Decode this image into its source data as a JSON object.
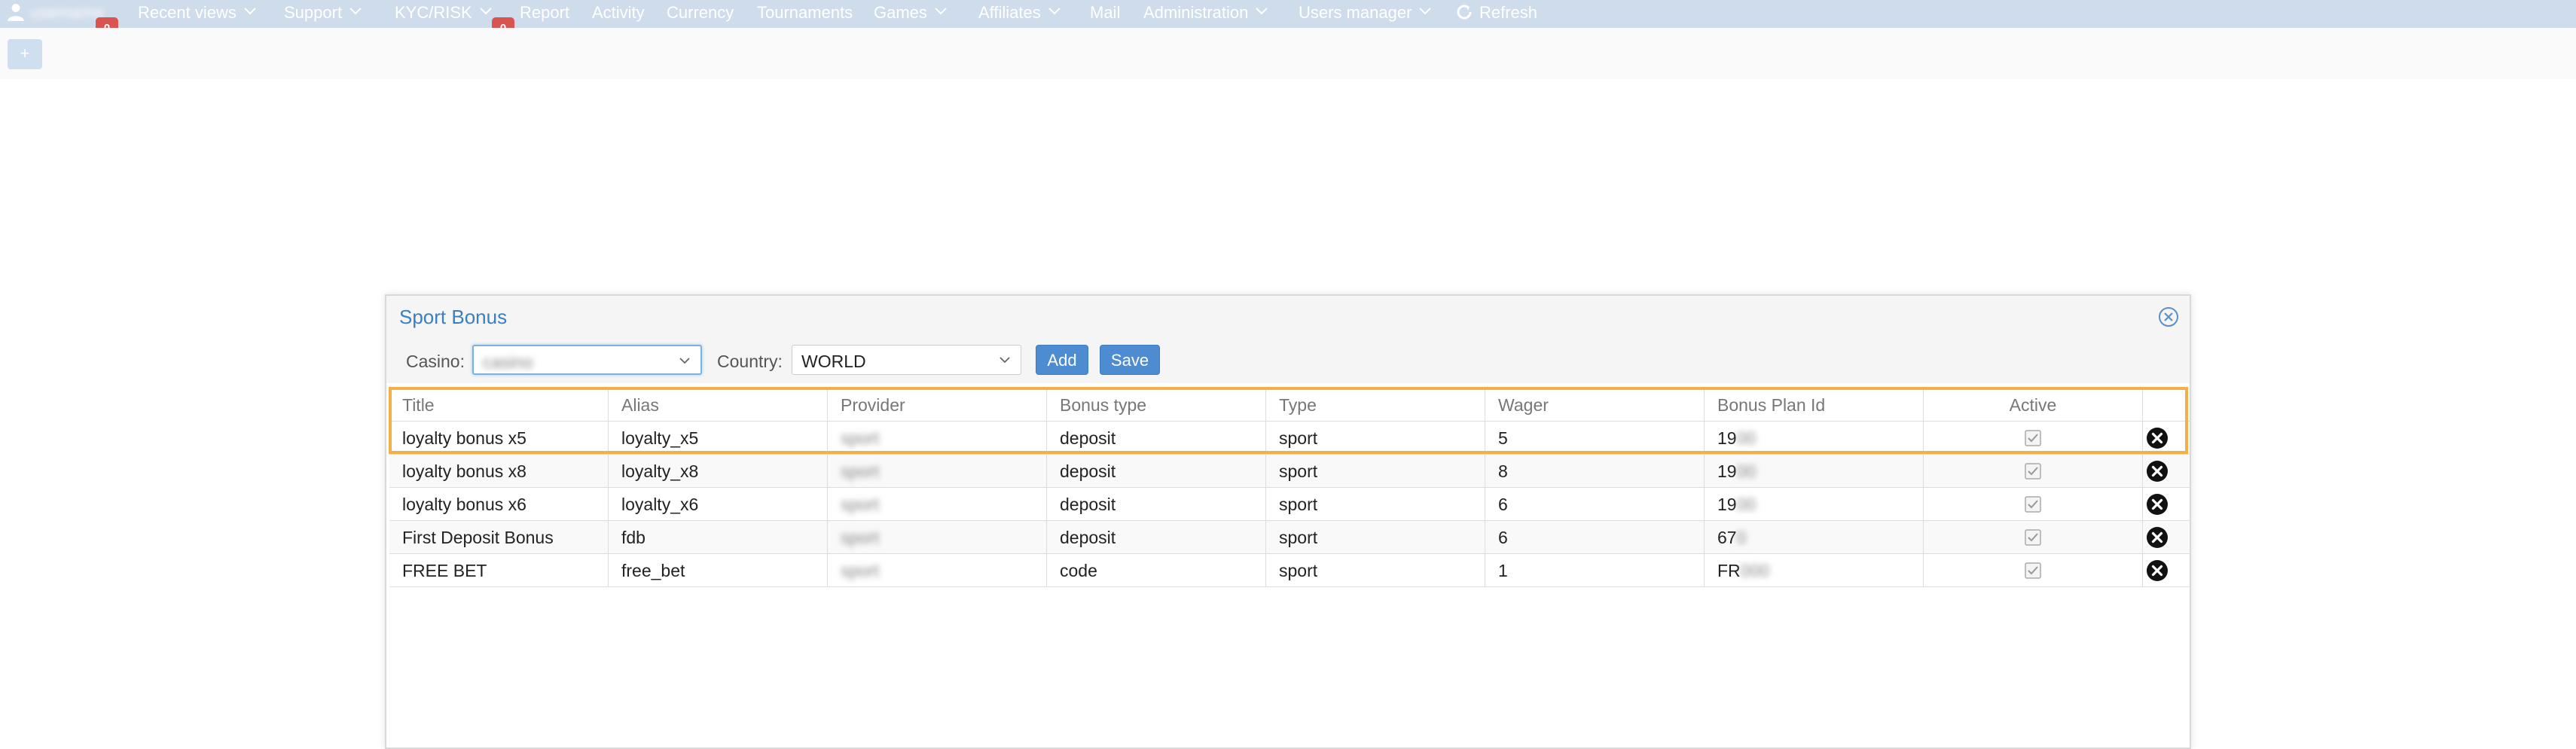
{
  "navbar": {
    "user_name": "username",
    "badges": [
      "0",
      "0"
    ],
    "items": [
      {
        "label": "Recent views",
        "dropdown": true
      },
      {
        "label": "Support",
        "dropdown": true
      },
      {
        "label": "KYC/RISK",
        "dropdown": true
      },
      {
        "label": "Report",
        "dropdown": false
      },
      {
        "label": "Activity",
        "dropdown": false
      },
      {
        "label": "Currency",
        "dropdown": false
      },
      {
        "label": "Tournaments",
        "dropdown": false
      },
      {
        "label": "Games",
        "dropdown": true
      },
      {
        "label": "Affiliates",
        "dropdown": true
      },
      {
        "label": "Mail",
        "dropdown": false
      },
      {
        "label": "Administration",
        "dropdown": true
      },
      {
        "label": "Users manager",
        "dropdown": true
      },
      {
        "label": "Refresh",
        "dropdown": false,
        "icon": "refresh-icon"
      }
    ]
  },
  "subbar": {
    "add_label": "+"
  },
  "modal": {
    "title": "Sport Bonus",
    "casino_label": "Casino:",
    "casino_value": "casino",
    "country_label": "Country:",
    "country_value": "WORLD",
    "add_label": "Add",
    "save_label": "Save"
  },
  "table": {
    "headers": [
      "Title",
      "Alias",
      "Provider",
      "Bonus type",
      "Type",
      "Wager",
      "Bonus Plan Id",
      "Active",
      ""
    ],
    "rows": [
      {
        "title": "loyalty bonus x5",
        "alias": "loyalty_x5",
        "provider": "sport",
        "bonus_type": "deposit",
        "type": "sport",
        "wager": "5",
        "plan_prefix": "19",
        "plan_rest": "00",
        "active": true
      },
      {
        "title": "loyalty bonus x8",
        "alias": "loyalty_x8",
        "provider": "sport",
        "bonus_type": "deposit",
        "type": "sport",
        "wager": "8",
        "plan_prefix": "19",
        "plan_rest": "00",
        "active": true
      },
      {
        "title": "loyalty bonus x6",
        "alias": "loyalty_x6",
        "provider": "sport",
        "bonus_type": "deposit",
        "type": "sport",
        "wager": "6",
        "plan_prefix": "19",
        "plan_rest": "00",
        "active": true
      },
      {
        "title": "First Deposit Bonus",
        "alias": "fdb",
        "provider": "sport",
        "bonus_type": "deposit",
        "type": "sport",
        "wager": "6",
        "plan_prefix": "67",
        "plan_rest": "0",
        "active": true
      },
      {
        "title": "FREE BET",
        "alias": "free_bet",
        "provider": "sport",
        "bonus_type": "code",
        "type": "sport",
        "wager": "1",
        "plan_prefix": "FR",
        "plan_rest": "000",
        "active": true
      }
    ]
  },
  "colors": {
    "navbar_bg": "#cfdcec",
    "badge": "#d9534f",
    "primary": "#4d8cd0",
    "title": "#3a7fc1",
    "highlight": "#f2b04a"
  }
}
